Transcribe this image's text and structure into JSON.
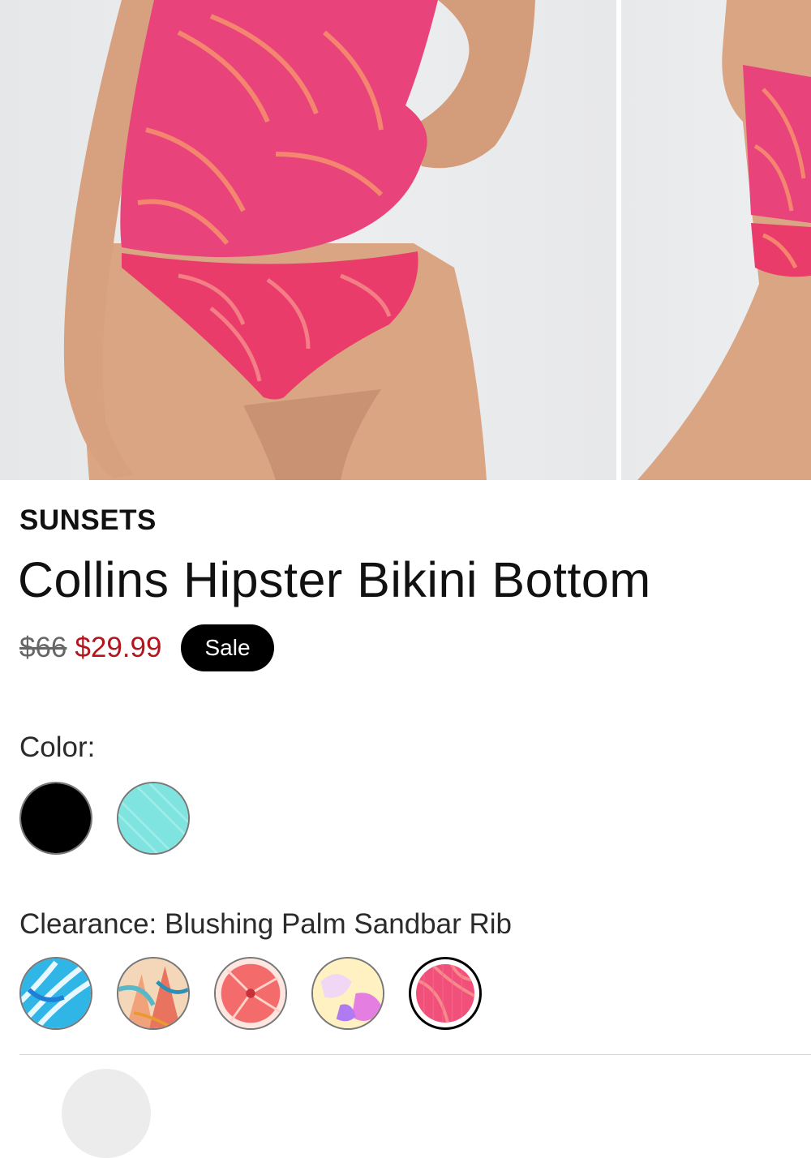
{
  "product": {
    "brand": "SUNSETS",
    "title": "Collins Hipster Bikini Bottom",
    "original_price": "$66",
    "sale_price": "$29.99",
    "badge": "Sale"
  },
  "color_section": {
    "label": "Color:",
    "swatches": [
      {
        "name": "black-swatch",
        "color": "#000000"
      },
      {
        "name": "aqua-swatch",
        "color": "#7fe3df"
      }
    ]
  },
  "clearance_section": {
    "label": "Clearance: Blushing Palm Sandbar Rib",
    "swatches": [
      {
        "name": "blue-print-swatch",
        "colors": [
          "#2fb5e6",
          "#ffffff"
        ]
      },
      {
        "name": "coral-print-swatch",
        "colors": [
          "#f2a27a",
          "#59b8c8"
        ]
      },
      {
        "name": "red-floral-swatch",
        "colors": [
          "#f36b6b",
          "#ffe6e0"
        ]
      },
      {
        "name": "yellow-floral-swatch",
        "colors": [
          "#fff1c2",
          "#e47ee0"
        ]
      },
      {
        "name": "pink-palm-swatch",
        "colors": [
          "#f0507a",
          "#f58a8a"
        ],
        "selected": true
      }
    ]
  },
  "colors": {
    "sale_price": "#b4151c",
    "badge_bg": "#000000",
    "swimsuit_pink": "#ea3c6b"
  }
}
